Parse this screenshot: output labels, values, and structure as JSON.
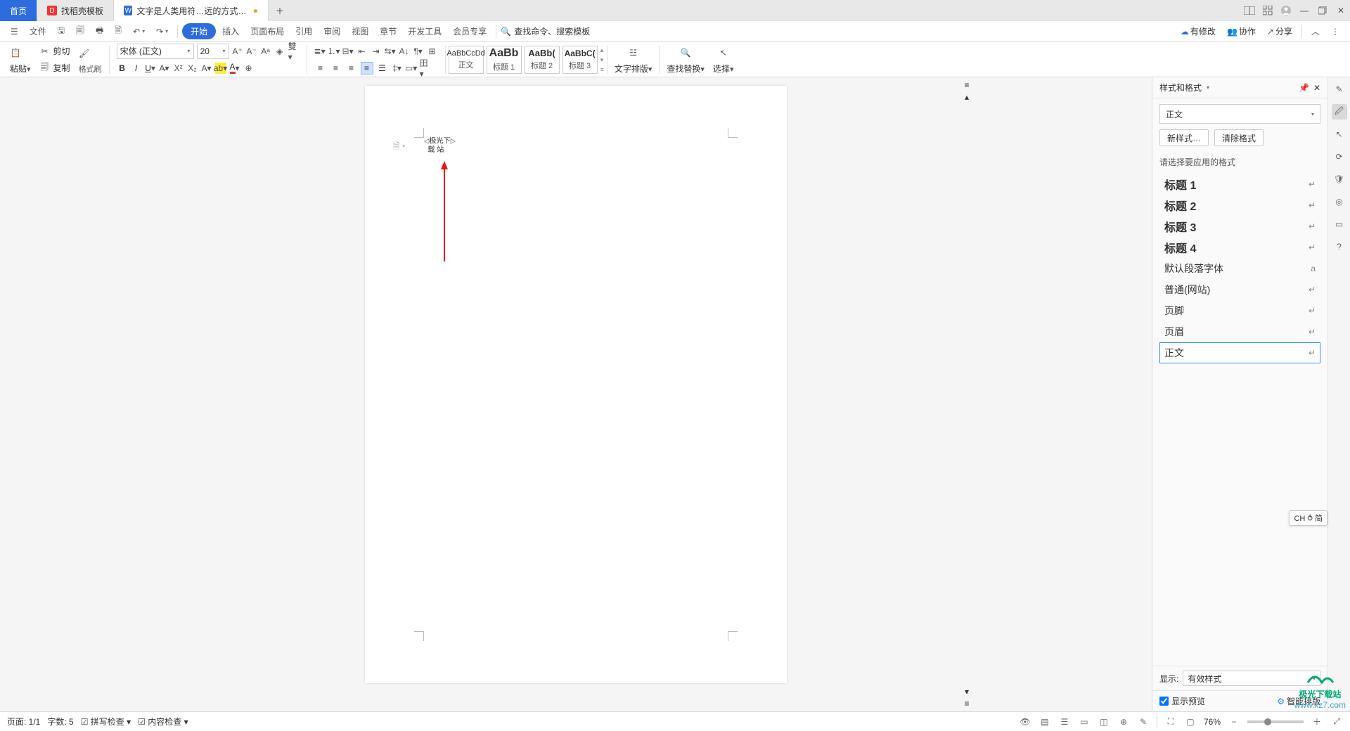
{
  "titlebar": {
    "home_tab": "首页",
    "template_tab": "找稻壳模板",
    "doc_tab": "文字是人类用符…远的方式和工具",
    "doc_modified": "●"
  },
  "menubar": {
    "file": "文件",
    "tabs": [
      "开始",
      "插入",
      "页面布局",
      "引用",
      "审阅",
      "视图",
      "章节",
      "开发工具",
      "会员专享"
    ],
    "search_placeholder": "查找命令、搜索模板",
    "track": "有修改",
    "collab": "协作",
    "share": "分享"
  },
  "ribbon": {
    "paste": "粘贴",
    "cut": "剪切",
    "copy": "复制",
    "format_painter": "格式刷",
    "font_name": "宋体 (正文)",
    "font_size": "20",
    "styles": [
      {
        "preview": "AaBbCcDd",
        "label": "正文"
      },
      {
        "preview": "AaBb",
        "label": "标题 1"
      },
      {
        "preview": "AaBb(",
        "label": "标题 2"
      },
      {
        "preview": "AaBbC(",
        "label": "标题 3"
      }
    ],
    "text_layout": "文字排版",
    "find_replace": "查找替换",
    "select": "选择"
  },
  "document": {
    "line1": "极光下",
    "line2": "载 站"
  },
  "panel": {
    "title": "样式和格式",
    "current_style": "正文",
    "new_style": "新样式…",
    "clear_format": "清除格式",
    "prompt": "请选择要应用的格式",
    "list": [
      {
        "name": "标题 1",
        "bold": true
      },
      {
        "name": "标题 2",
        "bold": true
      },
      {
        "name": "标题 3",
        "bold": true
      },
      {
        "name": "标题 4",
        "bold": true
      },
      {
        "name": "默认段落字体",
        "bold": false
      },
      {
        "name": "普通(网站)",
        "bold": false
      },
      {
        "name": "页脚",
        "bold": false
      },
      {
        "name": "页眉",
        "bold": false
      },
      {
        "name": "正文",
        "bold": false
      }
    ],
    "show_label": "显示:",
    "show_value": "有效样式",
    "show_preview": "显示预览",
    "smart_layout": "智能排版"
  },
  "status": {
    "page": "页面: 1/1",
    "words": "字数: 5",
    "spell": "拼写检查",
    "content": "内容检查",
    "zoom": "76%"
  },
  "ime": "CH ⥀ 简",
  "watermark": {
    "l1": "极光下载站",
    "l2": "www.xz7.com"
  }
}
